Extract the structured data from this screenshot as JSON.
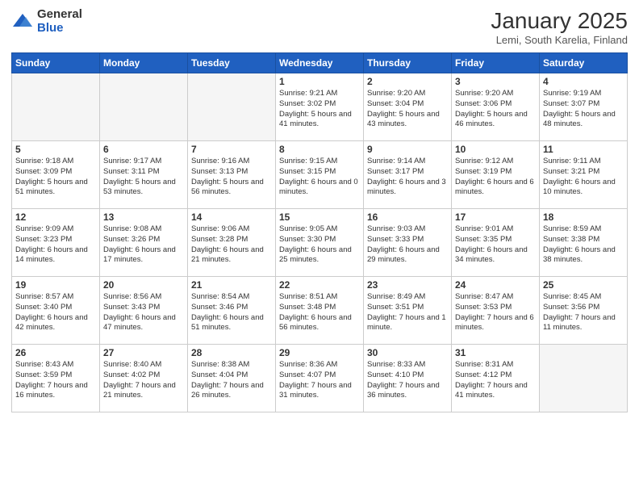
{
  "logo": {
    "general": "General",
    "blue": "Blue"
  },
  "title": "January 2025",
  "subtitle": "Lemi, South Karelia, Finland",
  "weekdays": [
    "Sunday",
    "Monday",
    "Tuesday",
    "Wednesday",
    "Thursday",
    "Friday",
    "Saturday"
  ],
  "weeks": [
    [
      {
        "day": "",
        "info": ""
      },
      {
        "day": "",
        "info": ""
      },
      {
        "day": "",
        "info": ""
      },
      {
        "day": "1",
        "info": "Sunrise: 9:21 AM\nSunset: 3:02 PM\nDaylight: 5 hours and 41 minutes."
      },
      {
        "day": "2",
        "info": "Sunrise: 9:20 AM\nSunset: 3:04 PM\nDaylight: 5 hours and 43 minutes."
      },
      {
        "day": "3",
        "info": "Sunrise: 9:20 AM\nSunset: 3:06 PM\nDaylight: 5 hours and 46 minutes."
      },
      {
        "day": "4",
        "info": "Sunrise: 9:19 AM\nSunset: 3:07 PM\nDaylight: 5 hours and 48 minutes."
      }
    ],
    [
      {
        "day": "5",
        "info": "Sunrise: 9:18 AM\nSunset: 3:09 PM\nDaylight: 5 hours and 51 minutes."
      },
      {
        "day": "6",
        "info": "Sunrise: 9:17 AM\nSunset: 3:11 PM\nDaylight: 5 hours and 53 minutes."
      },
      {
        "day": "7",
        "info": "Sunrise: 9:16 AM\nSunset: 3:13 PM\nDaylight: 5 hours and 56 minutes."
      },
      {
        "day": "8",
        "info": "Sunrise: 9:15 AM\nSunset: 3:15 PM\nDaylight: 6 hours and 0 minutes."
      },
      {
        "day": "9",
        "info": "Sunrise: 9:14 AM\nSunset: 3:17 PM\nDaylight: 6 hours and 3 minutes."
      },
      {
        "day": "10",
        "info": "Sunrise: 9:12 AM\nSunset: 3:19 PM\nDaylight: 6 hours and 6 minutes."
      },
      {
        "day": "11",
        "info": "Sunrise: 9:11 AM\nSunset: 3:21 PM\nDaylight: 6 hours and 10 minutes."
      }
    ],
    [
      {
        "day": "12",
        "info": "Sunrise: 9:09 AM\nSunset: 3:23 PM\nDaylight: 6 hours and 14 minutes."
      },
      {
        "day": "13",
        "info": "Sunrise: 9:08 AM\nSunset: 3:26 PM\nDaylight: 6 hours and 17 minutes."
      },
      {
        "day": "14",
        "info": "Sunrise: 9:06 AM\nSunset: 3:28 PM\nDaylight: 6 hours and 21 minutes."
      },
      {
        "day": "15",
        "info": "Sunrise: 9:05 AM\nSunset: 3:30 PM\nDaylight: 6 hours and 25 minutes."
      },
      {
        "day": "16",
        "info": "Sunrise: 9:03 AM\nSunset: 3:33 PM\nDaylight: 6 hours and 29 minutes."
      },
      {
        "day": "17",
        "info": "Sunrise: 9:01 AM\nSunset: 3:35 PM\nDaylight: 6 hours and 34 minutes."
      },
      {
        "day": "18",
        "info": "Sunrise: 8:59 AM\nSunset: 3:38 PM\nDaylight: 6 hours and 38 minutes."
      }
    ],
    [
      {
        "day": "19",
        "info": "Sunrise: 8:57 AM\nSunset: 3:40 PM\nDaylight: 6 hours and 42 minutes."
      },
      {
        "day": "20",
        "info": "Sunrise: 8:56 AM\nSunset: 3:43 PM\nDaylight: 6 hours and 47 minutes."
      },
      {
        "day": "21",
        "info": "Sunrise: 8:54 AM\nSunset: 3:46 PM\nDaylight: 6 hours and 51 minutes."
      },
      {
        "day": "22",
        "info": "Sunrise: 8:51 AM\nSunset: 3:48 PM\nDaylight: 6 hours and 56 minutes."
      },
      {
        "day": "23",
        "info": "Sunrise: 8:49 AM\nSunset: 3:51 PM\nDaylight: 7 hours and 1 minute."
      },
      {
        "day": "24",
        "info": "Sunrise: 8:47 AM\nSunset: 3:53 PM\nDaylight: 7 hours and 6 minutes."
      },
      {
        "day": "25",
        "info": "Sunrise: 8:45 AM\nSunset: 3:56 PM\nDaylight: 7 hours and 11 minutes."
      }
    ],
    [
      {
        "day": "26",
        "info": "Sunrise: 8:43 AM\nSunset: 3:59 PM\nDaylight: 7 hours and 16 minutes."
      },
      {
        "day": "27",
        "info": "Sunrise: 8:40 AM\nSunset: 4:02 PM\nDaylight: 7 hours and 21 minutes."
      },
      {
        "day": "28",
        "info": "Sunrise: 8:38 AM\nSunset: 4:04 PM\nDaylight: 7 hours and 26 minutes."
      },
      {
        "day": "29",
        "info": "Sunrise: 8:36 AM\nSunset: 4:07 PM\nDaylight: 7 hours and 31 minutes."
      },
      {
        "day": "30",
        "info": "Sunrise: 8:33 AM\nSunset: 4:10 PM\nDaylight: 7 hours and 36 minutes."
      },
      {
        "day": "31",
        "info": "Sunrise: 8:31 AM\nSunset: 4:12 PM\nDaylight: 7 hours and 41 minutes."
      },
      {
        "day": "",
        "info": ""
      }
    ]
  ]
}
